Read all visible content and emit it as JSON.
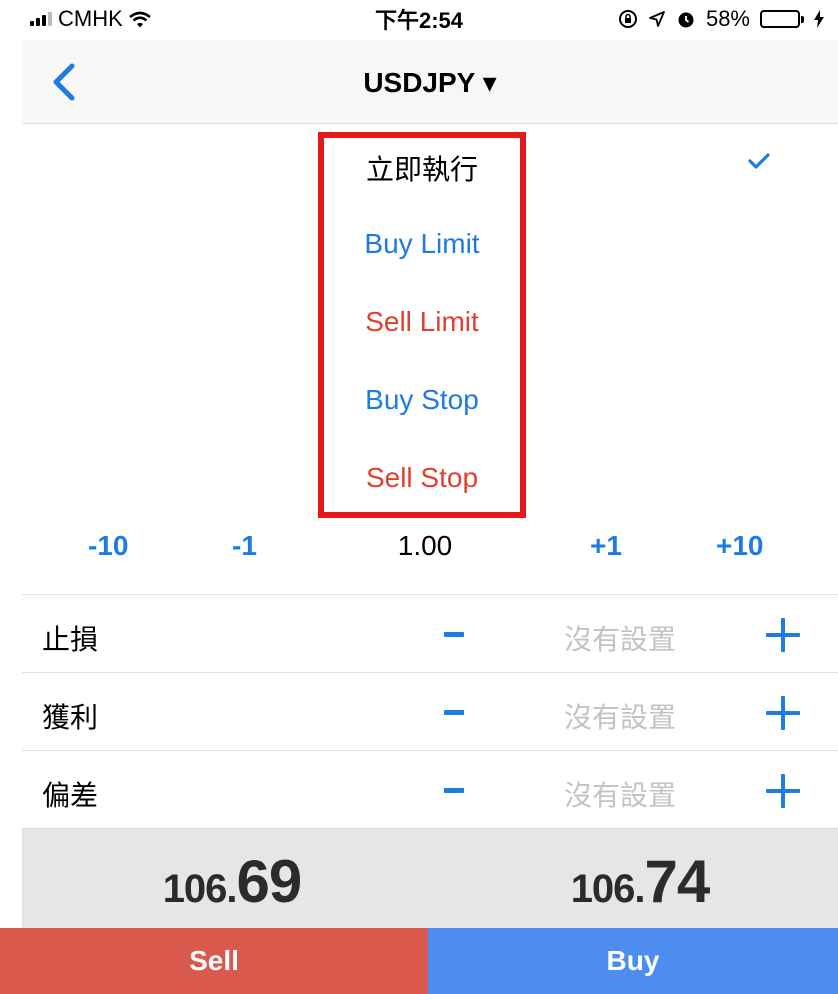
{
  "status_bar": {
    "carrier": "CMHK",
    "time": "下午2:54",
    "battery_percent": "58%",
    "battery_level": 0.58
  },
  "nav": {
    "title": "USDJPY ▾"
  },
  "order_type_picker": {
    "options": [
      {
        "label": "立即執行",
        "color": "#000000",
        "selected": true
      },
      {
        "label": "Buy Limit",
        "color": "#1e7be0"
      },
      {
        "label": "Sell Limit",
        "color": "#e2402f"
      },
      {
        "label": "Buy Stop",
        "color": "#1e7be0"
      },
      {
        "label": "Sell Stop",
        "color": "#e2402f"
      }
    ],
    "highlight_color": "#e61a1a"
  },
  "volume": {
    "minus10": "-10",
    "minus1": "-1",
    "value": "1.00",
    "plus1": "+1",
    "plus10": "+10"
  },
  "params": [
    {
      "label": "止損",
      "value": "沒有設置"
    },
    {
      "label": "獲利",
      "value": "沒有設置"
    },
    {
      "label": "偏差",
      "value": "沒有設置"
    }
  ],
  "prices": {
    "bid_prefix": "106.",
    "bid_suffix": "69",
    "ask_prefix": "106.",
    "ask_suffix": "74"
  },
  "actions": {
    "sell": "Sell",
    "buy": "Buy",
    "sell_color": "#d95a4d",
    "buy_color": "#4c8def"
  }
}
